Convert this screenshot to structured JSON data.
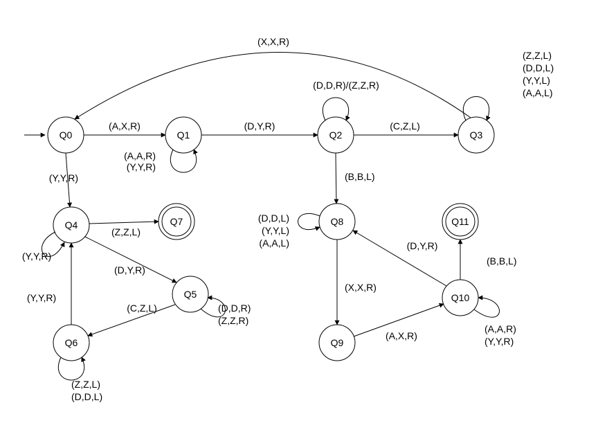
{
  "states": {
    "q0": "Q0",
    "q1": "Q1",
    "q2": "Q2",
    "q3": "Q3",
    "q4": "Q4",
    "q5": "Q5",
    "q6": "Q6",
    "q7": "Q7",
    "q8": "Q8",
    "q9": "Q9",
    "q10": "Q10",
    "q11": "Q11"
  },
  "edges": {
    "q0_q1": "(A,X,R)",
    "q1_q2": "(D,Y,R)",
    "q2_q3": "(C,Z,L)",
    "q3_q0": "(X,X,R)",
    "q0_q4": "(Y,Y,R)",
    "q4_q7": "(Z,Z,L)",
    "q4_q5": "(D,Y,R)",
    "q5_q6": "(C,Z,L)",
    "q6_q4": "(Y,Y,R)",
    "q2_q8": "(B,B,L)",
    "q8_q9": "(X,X,R)",
    "q9_q10": "(A,X,R)",
    "q10_q8": "(D,Y,R)",
    "q10_q11": "(B,B,L)",
    "q1_loop_a": "(A,A,R)",
    "q1_loop_b": "(Y,Y,R)",
    "q2_loop": "(D,D,R)/(Z,Z,R)",
    "q3_loop_a": "(Z,Z,L)",
    "q3_loop_b": "(D,D,L)",
    "q3_loop_c": "(Y,Y,L)",
    "q3_loop_d": "(A,A,L)",
    "q4_loop": "(Y,Y,R)",
    "q5_loop_a": "(D,D,R)",
    "q5_loop_b": "(Z,Z,R)",
    "q6_loop_a": "(Z,Z,L)",
    "q6_loop_b": "(D,D,L)",
    "q8_loop_a": "(D,D,L)",
    "q8_loop_b": "(Y,Y,L)",
    "q8_loop_c": "(A,A,L)",
    "q10_loop_a": "(A,A,R)",
    "q10_loop_b": "(Y,Y,R)"
  }
}
